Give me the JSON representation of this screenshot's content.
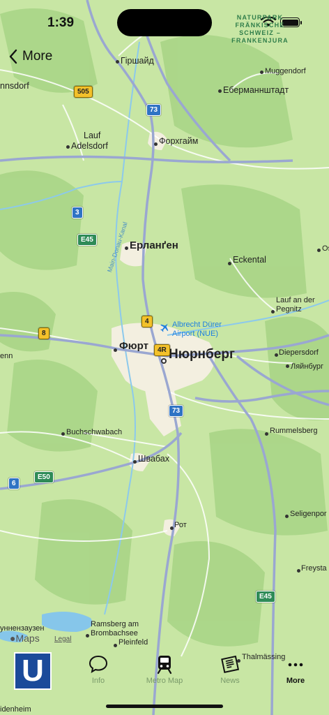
{
  "status_bar": {
    "time": "1:39"
  },
  "nav": {
    "back_label": "More"
  },
  "map": {
    "park_label": "NATURPARK FRÄNKISCHE SCHWEIZ – FRANKENJURA",
    "canal_label": "Main-Donau-Kanal",
    "places": {
      "girshaid": "Гіршайд",
      "muggendorf": "Muggendorf",
      "nnsdorf": "nnsdorf",
      "ebermannstadt": "Еберманнштадт",
      "lauf": "Lauf",
      "adelsdorf": "Adelsdorf",
      "forchheim": "Форхгайм",
      "erlangen": "Ерланґен",
      "eckental": "Eckental",
      "os": "Os",
      "lauf_pegnitz": "Lauf an der Pegnitz",
      "airport": "Albrecht Dürer Airport (NUE)",
      "furth": "Фюрт",
      "nurnberg": "Нюрнберг",
      "enn": "enn",
      "diepersdorf": "Diepersdorf",
      "lyainburg": "Ляйнбург",
      "buchschwabach": "Buchschwabach",
      "rummelsberg": "Rummelsberg",
      "schwabach": "Швабах",
      "seligenporten": "Seligenpor",
      "roth": "Рот",
      "freystadt": "Freysta",
      "unnenhausen": "уннензаузен",
      "ramsberg": "Ramsberg am Brombachsee",
      "pleinfeld": "Pleinfeld",
      "thalmassing": "Thalmässing",
      "idenheim": "idenheim"
    },
    "shields": {
      "b505": "505",
      "a73_top": "73",
      "a3": "3",
      "e45_top": "E45",
      "b8": "8",
      "a4": "4",
      "a4r": "4R",
      "a73_mid": "73",
      "a6": "6",
      "e50": "E50",
      "e45_bot": "E45"
    },
    "colors": {
      "land": "#c8e6a4",
      "forest": "#a8d488",
      "urban": "#f4f0e2",
      "motorway": "#8e9dc9",
      "water": "#7fc3ea"
    }
  },
  "attribution": {
    "brand": "Maps",
    "legal": "Legal"
  },
  "tabbar": {
    "logo_letter": "U",
    "tabs": [
      {
        "label": "Info",
        "icon": "speech-bubble-icon"
      },
      {
        "label": "Metro Map",
        "icon": "train-icon"
      },
      {
        "label": "News",
        "icon": "newspaper-icon"
      },
      {
        "label": "More",
        "icon": "ellipsis-icon"
      }
    ]
  }
}
